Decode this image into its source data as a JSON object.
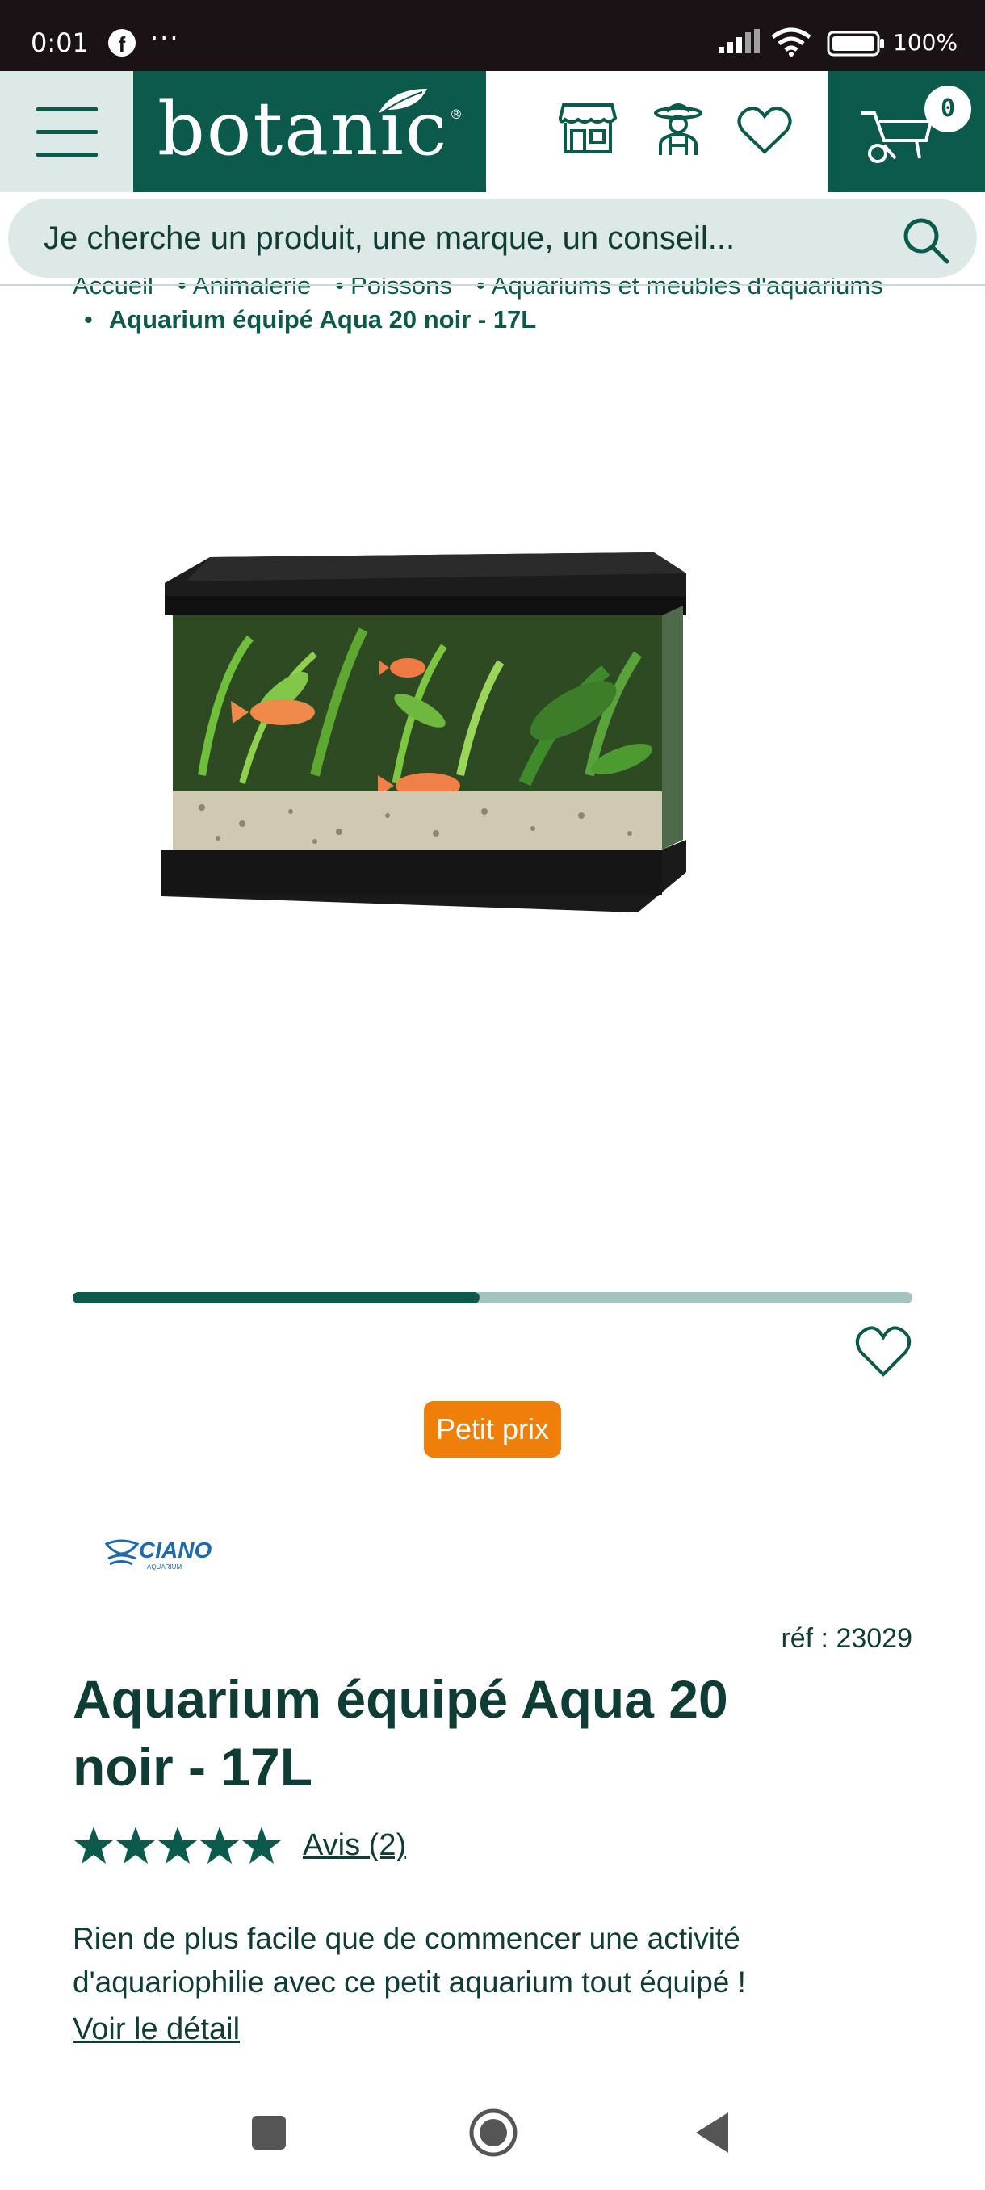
{
  "status_bar": {
    "time": "0:01",
    "dots": "···",
    "battery": "100%",
    "icons": [
      "facebook-icon",
      "signal-icon",
      "wifi-icon",
      "battery-icon"
    ]
  },
  "header": {
    "logo": "botanic",
    "logo_mark": "®",
    "cart_count": "0",
    "icons": [
      "menu-icon",
      "store-icon",
      "gardener-icon",
      "heart-icon",
      "wheelbarrow-icon"
    ]
  },
  "search": {
    "placeholder": "Je cherche un produit, une marque, un conseil..."
  },
  "breadcrumb": {
    "items": [
      "Accueil",
      "Animalerie",
      "Poissons",
      "Aquariums et meubles d'aquariums"
    ],
    "current": "Aquarium équipé Aqua 20 noir - 17L"
  },
  "carousel": {
    "progress": 0.485
  },
  "product": {
    "badge": "Petit prix",
    "brand": "CIANO",
    "brand_sub": "AQUARIUM",
    "ref": "réf : 23029",
    "title": "Aquarium équipé Aqua 20 noir - 17L",
    "rating": 5,
    "reviews": "Avis (2)",
    "description": "Rien de plus facile que de commencer une activité d'aquariophilie avec ce petit aquarium tout équipé !",
    "detail_link": "Voir le détail"
  },
  "colors": {
    "brand_green": "#0b5a4b",
    "light_green": "#dce9e6",
    "badge_orange": "#f07f0a"
  }
}
